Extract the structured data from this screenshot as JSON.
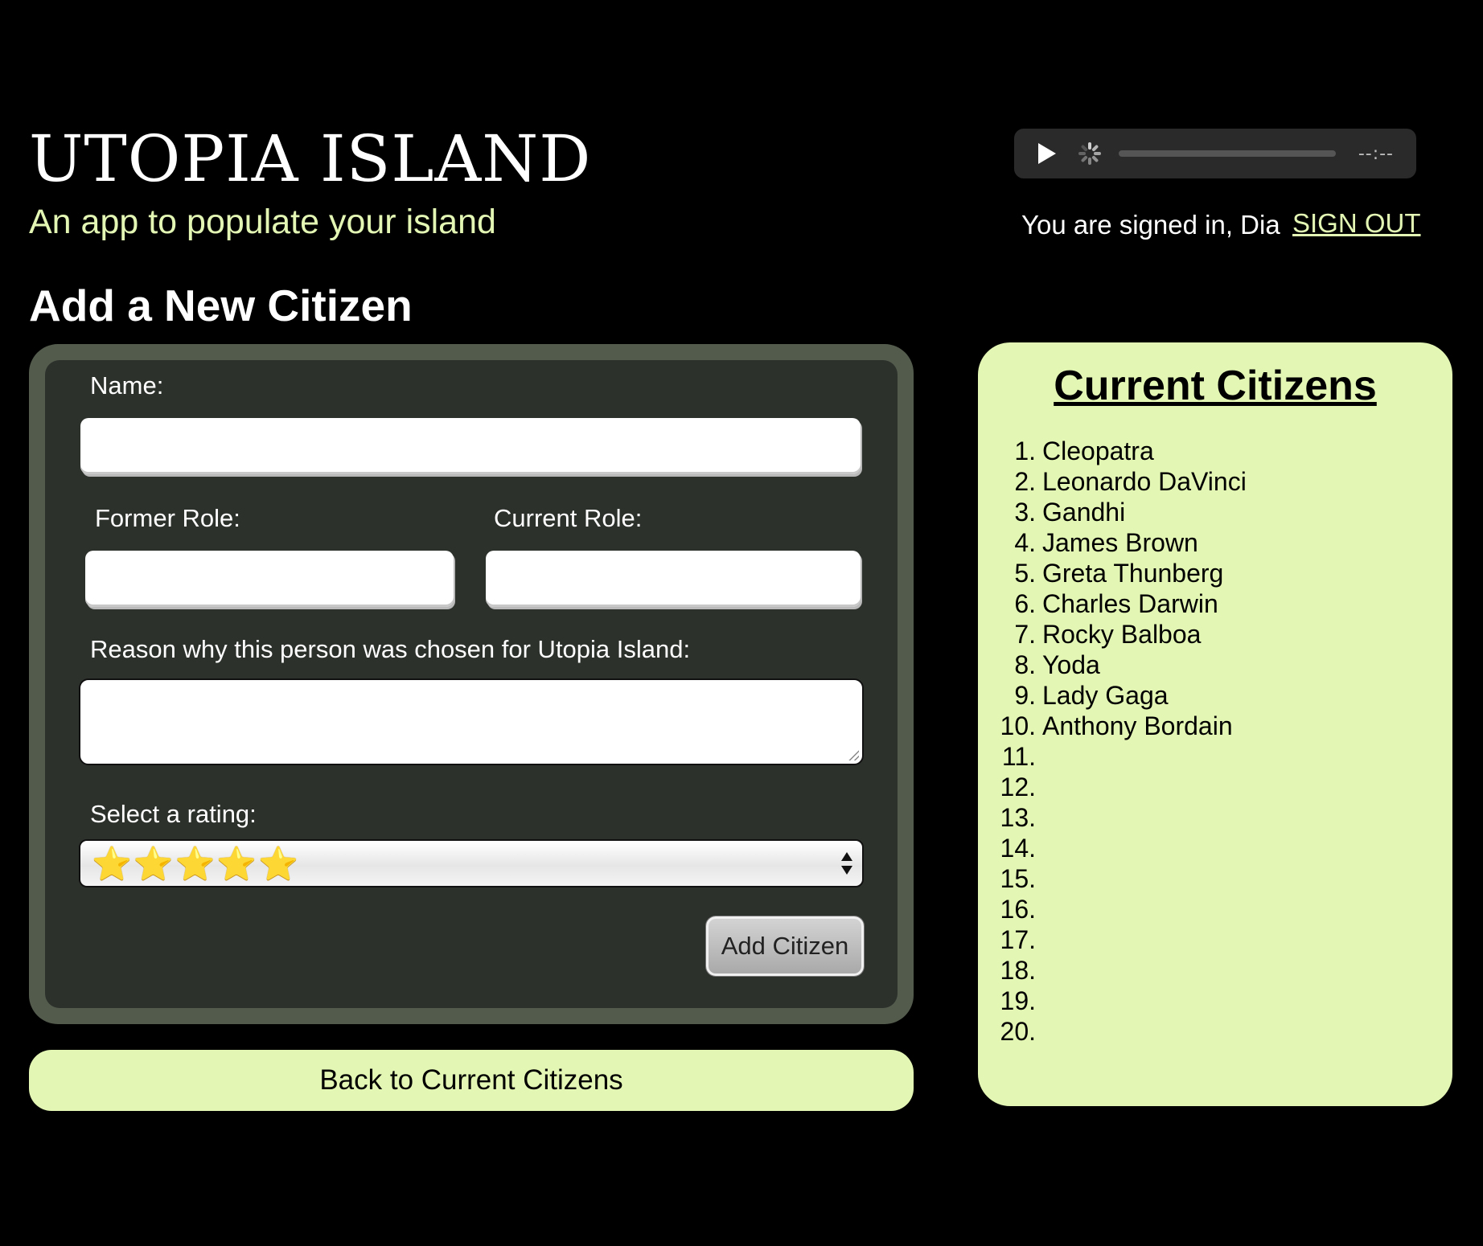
{
  "header": {
    "title": "UTOPIA ISLAND",
    "tagline": "An app to populate your island"
  },
  "audio_player": {
    "time": "--:--",
    "icons": [
      "play-icon",
      "loading-spinner-icon"
    ]
  },
  "session": {
    "signed_in_text": "You are signed in, Dia",
    "sign_out_label": "SIGN OUT"
  },
  "form": {
    "heading": "Add a New Citizen",
    "name_label": "Name:",
    "name_value": "",
    "former_role_label": "Former Role:",
    "former_role_value": "",
    "current_role_label": "Current Role:",
    "current_role_value": "",
    "reason_label": "Reason why this person was chosen for Utopia Island:",
    "reason_value": "",
    "rating_label": "Select a rating:",
    "rating_selected": "⭐⭐⭐⭐⭐",
    "rating_value": 5,
    "submit_label": "Add Citizen"
  },
  "back_button_label": "Back to Current Citizens",
  "citizens": {
    "title": "Current Citizens",
    "items": [
      {
        "num": "1.",
        "name": "Cleopatra"
      },
      {
        "num": "2.",
        "name": "Leonardo DaVinci"
      },
      {
        "num": "3.",
        "name": "Gandhi"
      },
      {
        "num": "4.",
        "name": "James Brown"
      },
      {
        "num": "5.",
        "name": "Greta Thunberg"
      },
      {
        "num": "6.",
        "name": "Charles Darwin"
      },
      {
        "num": "7.",
        "name": "Rocky Balboa"
      },
      {
        "num": "8.",
        "name": "Yoda"
      },
      {
        "num": "9.",
        "name": "Lady Gaga"
      },
      {
        "num": "10.",
        "name": "Anthony Bordain"
      },
      {
        "num": "11.",
        "name": ""
      },
      {
        "num": "12.",
        "name": ""
      },
      {
        "num": "13.",
        "name": ""
      },
      {
        "num": "14.",
        "name": ""
      },
      {
        "num": "15.",
        "name": ""
      },
      {
        "num": "16.",
        "name": ""
      },
      {
        "num": "17.",
        "name": ""
      },
      {
        "num": "18.",
        "name": ""
      },
      {
        "num": "19.",
        "name": ""
      },
      {
        "num": "20.",
        "name": ""
      }
    ]
  },
  "colors": {
    "background": "#000000",
    "accent": "#e3f6b3",
    "form_frame": "#535b4d",
    "form_body": "#2d312c"
  }
}
